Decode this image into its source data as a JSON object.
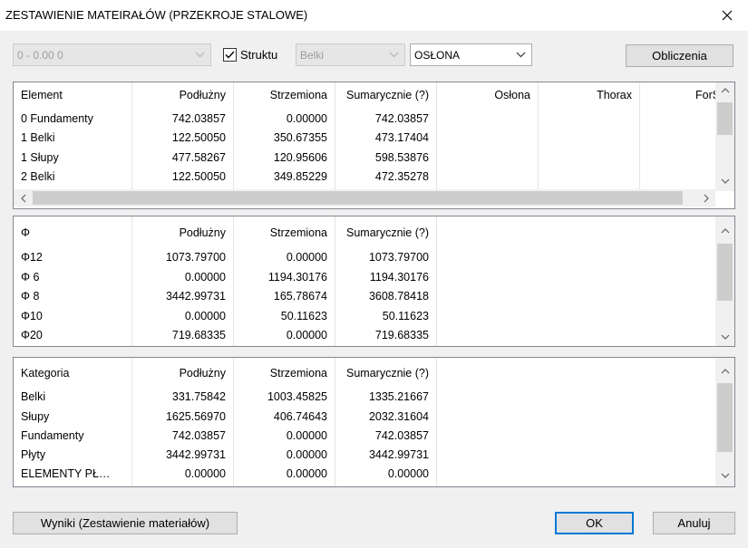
{
  "window": {
    "title": "ZESTAWIENIE MATEIRAŁÓW (PRZEKROJE STALOWE)"
  },
  "icons": {
    "close": "close-icon",
    "chevron": "chevron-down-icon",
    "check": "checkmark-icon"
  },
  "toolbar": {
    "range_value": "0 - 0.00 0",
    "struktu_label": "Struktu",
    "struktu_checked": true,
    "type_value": "Belki",
    "cover_value": "OSŁONA",
    "calc_label": "Obliczenia"
  },
  "grid_element": {
    "headers": [
      "Element",
      "Podłużny",
      "Strzemiona",
      "Sumarycznie (?)",
      "Osłona",
      "Thorax",
      "ForSt"
    ],
    "rows": [
      [
        "0 Fundamenty",
        "742.03857",
        "0.00000",
        "742.03857"
      ],
      [
        "1 Belki",
        "122.50050",
        "350.67355",
        "473.17404"
      ],
      [
        "1 Słupy",
        "477.58267",
        "120.95606",
        "598.53876"
      ],
      [
        "2 Belki",
        "122.50050",
        "349.85229",
        "472.35278"
      ]
    ]
  },
  "grid_phi": {
    "headers": [
      "Φ",
      "Podłużny",
      "Strzemiona",
      "Sumarycznie (?)"
    ],
    "rows": [
      [
        "Φ12",
        "1073.79700",
        "0.00000",
        "1073.79700"
      ],
      [
        "Φ 6",
        "0.00000",
        "1194.30176",
        "1194.30176"
      ],
      [
        "Φ 8",
        "3442.99731",
        "165.78674",
        "3608.78418"
      ],
      [
        "Φ10",
        "0.00000",
        "50.11623",
        "50.11623"
      ],
      [
        "Φ20",
        "719.68335",
        "0.00000",
        "719.68335"
      ]
    ]
  },
  "grid_category": {
    "headers": [
      "Kategoria",
      "Podłużny",
      "Strzemiona",
      "Sumarycznie (?)"
    ],
    "rows": [
      [
        "Belki",
        "331.75842",
        "1003.45825",
        "1335.21667"
      ],
      [
        "Słupy",
        "1625.56970",
        "406.74643",
        "2032.31604"
      ],
      [
        "Fundamenty",
        "742.03857",
        "0.00000",
        "742.03857"
      ],
      [
        "Płyty",
        "3442.99731",
        "0.00000",
        "3442.99731"
      ],
      [
        "ELEMENTY PŁ…",
        "0.00000",
        "0.00000",
        "0.00000"
      ]
    ]
  },
  "footer": {
    "results_label": "Wyniki (Zestawienie materiałów)",
    "ok_label": "OK",
    "cancel_label": "Anuluj"
  }
}
